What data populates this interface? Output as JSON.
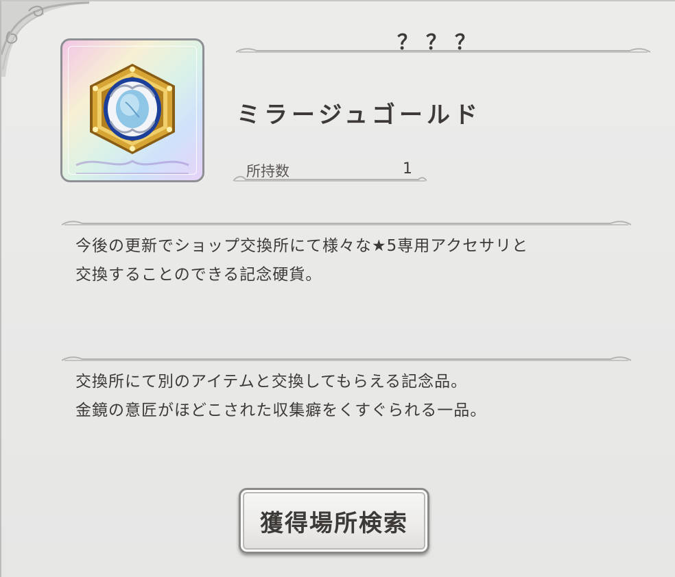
{
  "item": {
    "rarity": "？？？",
    "name": "ミラージュゴールド",
    "icon": "mirage-gold-coin-icon",
    "count_label": "所持数",
    "count_value": "1"
  },
  "description": {
    "effect": "今後の更新でショップ交換所にて様々な★5専用アクセサリと\n交換することのできる記念硬貨。",
    "flavor": "交換所にて別のアイテムと交換してもらえる記念品。\n金鏡の意匠がほどこされた収集癖をくすぐられる一品。"
  },
  "actions": {
    "search_label": "獲得場所検索"
  },
  "colors": {
    "text": "#3d3936",
    "gold": "#c79a2e",
    "blue": "#1c3f9a",
    "panel": "#e8e8e7"
  }
}
